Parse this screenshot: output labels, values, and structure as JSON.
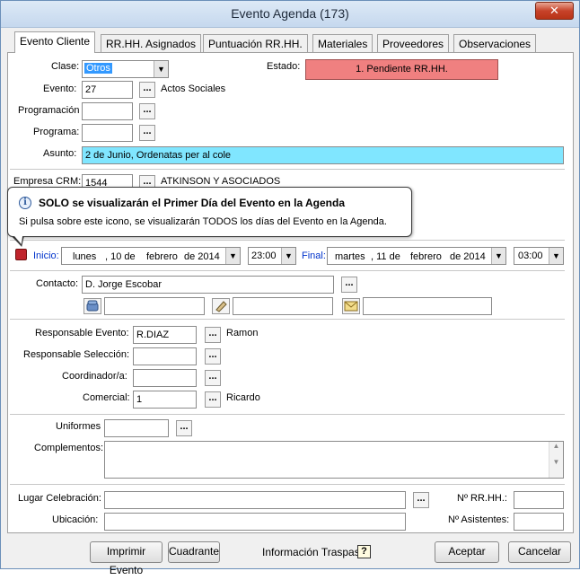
{
  "window": {
    "title": "Evento Agenda (173)",
    "close_label": "✕"
  },
  "tabs": [
    {
      "label": "Evento Cliente"
    },
    {
      "label": "RR.HH. Asignados"
    },
    {
      "label": "Puntuación RR.HH."
    },
    {
      "label": "Materiales"
    },
    {
      "label": "Proveedores"
    },
    {
      "label": "Observaciones"
    }
  ],
  "form": {
    "clase_label": "Clase:",
    "clase_value": "Otros",
    "estado_label": "Estado:",
    "estado_value": "1. Pendiente RR.HH.",
    "estado_color": "#f08080",
    "evento_label": "Evento:",
    "evento_value": "27",
    "evento_desc": "Actos Sociales",
    "programacion_label": "Programación",
    "programacion_value": "",
    "programa_label": "Programa:",
    "programa_value": "",
    "asunto_label": "Asunto:",
    "asunto_value": "2 de Junio, Ordenatas per al cole",
    "empresa_label": "Empresa CRM:",
    "empresa_value": "1544",
    "empresa_desc": "ATKINSON Y ASOCIADOS",
    "ellipsis": "..."
  },
  "tooltip": {
    "title": "SOLO se visualizarán el Primer Día del Evento en la Agenda",
    "body": "Si pulsa sobre este icono, se visualizarán TODOS los días del Evento en la Agenda.",
    "icon_glyph": "i"
  },
  "dates": {
    "inicio_label": "Inicio:",
    "inicio": {
      "weekday": "lunes",
      "day": ", 10 de",
      "month": "febrero",
      "year": "de 2014",
      "time": "23:00"
    },
    "final_label": "Final:",
    "final": {
      "weekday": "martes",
      "day": ", 11 de",
      "month": "febrero",
      "year": "de 2014",
      "time": "03:00"
    }
  },
  "contacto": {
    "label": "Contacto:",
    "value": "D. Jorge Escobar",
    "phone": "",
    "fax": "",
    "email": ""
  },
  "responsables": {
    "evento_label": "Responsable Evento:",
    "evento_value": "R.DIAZ",
    "evento_name": "Ramon",
    "seleccion_label": "Responsable Selección:",
    "seleccion_value": "",
    "coordinador_label": "Coordinador/a:",
    "coordinador_value": "",
    "comercial_label": "Comercial:",
    "comercial_value": "1",
    "comercial_name": "Ricardo"
  },
  "extras": {
    "uniformes_label": "Uniformes",
    "uniformes_value": "",
    "complementos_label": "Complementos:",
    "complementos_value": ""
  },
  "lugar": {
    "celebracion_label": "Lugar Celebración:",
    "celebracion_value": "",
    "ubicacion_label": "Ubicación:",
    "ubicacion_value": "",
    "rrhh_label": "Nº RR.HH.:",
    "rrhh_value": "",
    "asistentes_label": "Nº Asistentes:",
    "asistentes_value": ""
  },
  "footer": {
    "imprimir": "Imprimir Evento",
    "cuadrante": "Cuadrante",
    "traspaso_label": "Información Traspaso:",
    "traspaso_icon": "?",
    "aceptar": "Aceptar",
    "cancelar": "Cancelar"
  }
}
